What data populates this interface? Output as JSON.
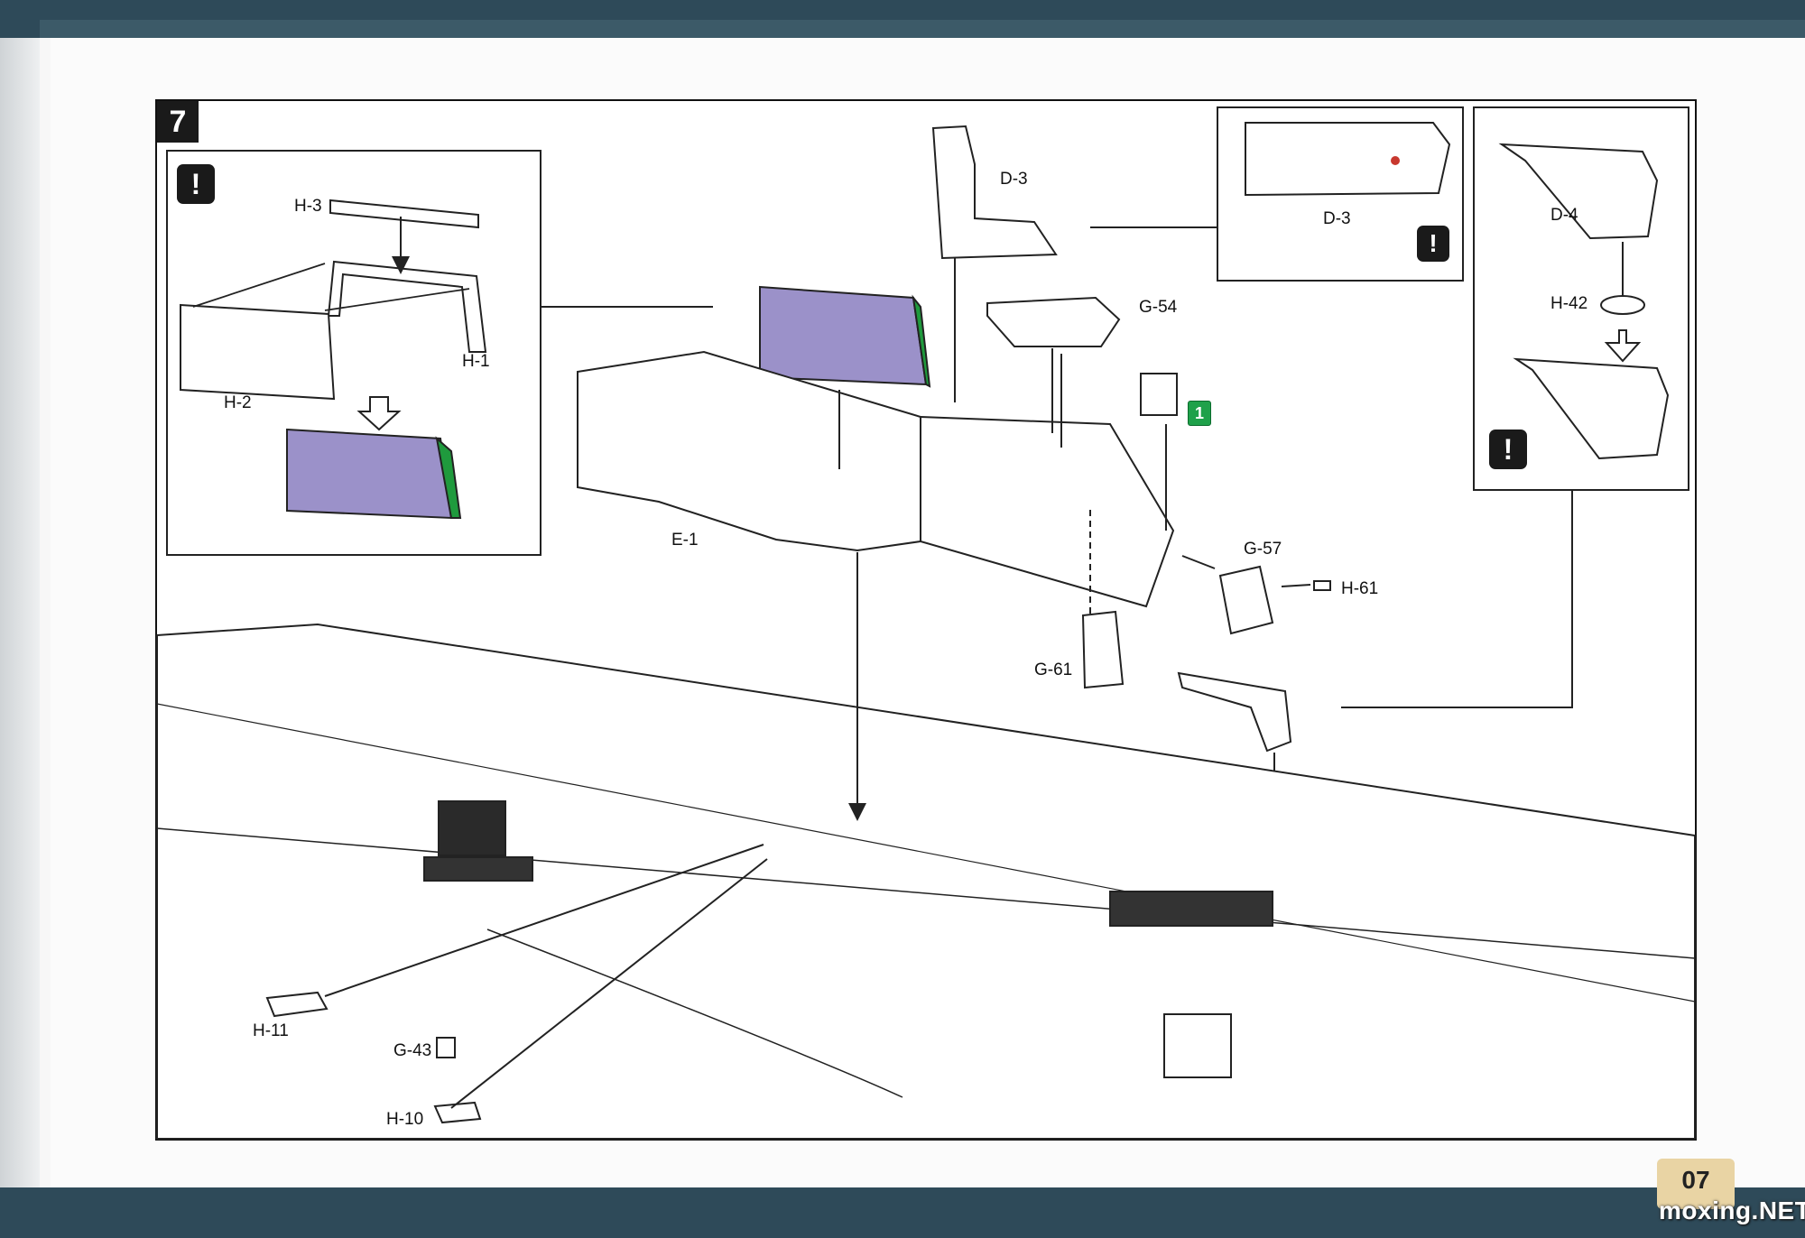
{
  "step": {
    "number": "7"
  },
  "warning_symbol": "!",
  "inset_top_left": {
    "parts": {
      "top": "H-3",
      "frame": "H-1",
      "panel": "H-2"
    }
  },
  "superstructure": {
    "hull_part": "E-1",
    "tower_top": "D-3",
    "mid_deck": "G-54",
    "side_plate": "G-57",
    "small_bar": "H-61",
    "lower_plate": "G-61"
  },
  "inset_top_right": {
    "part": "D-3"
  },
  "inset_crane": {
    "arm": "D-4",
    "base": "H-42"
  },
  "hull_parts": {
    "a": "H-11",
    "b": "G-43",
    "c": "H-10"
  },
  "badge": {
    "number": "1"
  },
  "colors": {
    "purple": "#9b91c9",
    "green": "#1f9a3d",
    "frame": "#111111",
    "topbar": "#2e4a59"
  },
  "footer": {
    "page_number": "07",
    "watermark": "moxing.NET"
  }
}
